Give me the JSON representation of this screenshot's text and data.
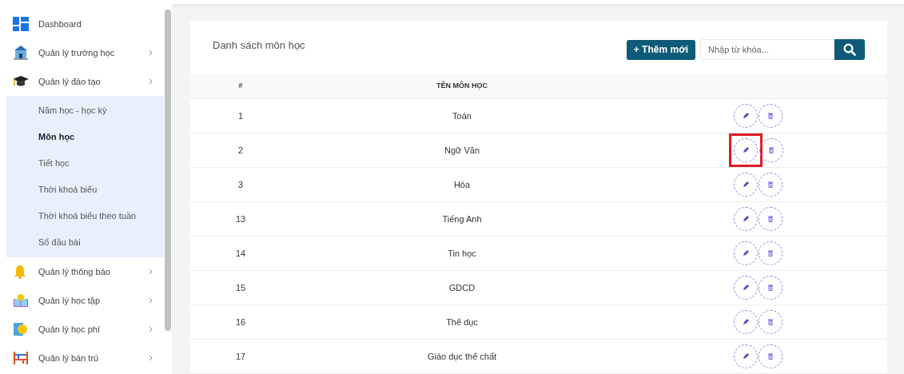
{
  "sidebar": {
    "items": [
      {
        "label": "Dashboard",
        "has_arrow": false
      },
      {
        "label": "Quản lý trường học",
        "has_arrow": true
      },
      {
        "label": "Quản lý đào tạo",
        "has_arrow": true,
        "expanded": true,
        "children": [
          {
            "label": "Năm học - học kỳ",
            "selected": false
          },
          {
            "label": "Môn học",
            "selected": true
          },
          {
            "label": "Tiết học",
            "selected": false
          },
          {
            "label": "Thời khoá biểu",
            "selected": false
          },
          {
            "label": "Thời khoá biểu theo tuần",
            "selected": false
          },
          {
            "label": "Sổ đầu bài",
            "selected": false
          }
        ]
      },
      {
        "label": "Quản lý thông báo",
        "has_arrow": true
      },
      {
        "label": "Quản lý học tập",
        "has_arrow": true
      },
      {
        "label": "Quản lý học phí",
        "has_arrow": true
      },
      {
        "label": "Quản lý bán trú",
        "has_arrow": true
      }
    ]
  },
  "card": {
    "title": "Danh sách môn học",
    "add_button": "+ Thêm mới",
    "search": {
      "placeholder": "Nhập từ khóa..."
    }
  },
  "table": {
    "columns": [
      "#",
      "TÊN MÔN HỌC"
    ],
    "rows": [
      {
        "number": "1",
        "name": "Toán",
        "highlighted": false
      },
      {
        "number": "2",
        "name": "Ngữ Văn",
        "highlighted": true
      },
      {
        "number": "3",
        "name": "Hóa",
        "highlighted": false
      },
      {
        "number": "13",
        "name": "Tiếng Anh",
        "highlighted": false
      },
      {
        "number": "14",
        "name": "Tin học",
        "highlighted": false
      },
      {
        "number": "15",
        "name": "GDCD",
        "highlighted": false
      },
      {
        "number": "16",
        "name": "Thể dục",
        "highlighted": false
      },
      {
        "number": "17",
        "name": "Giáo dục thể chất",
        "highlighted": false
      }
    ]
  }
}
